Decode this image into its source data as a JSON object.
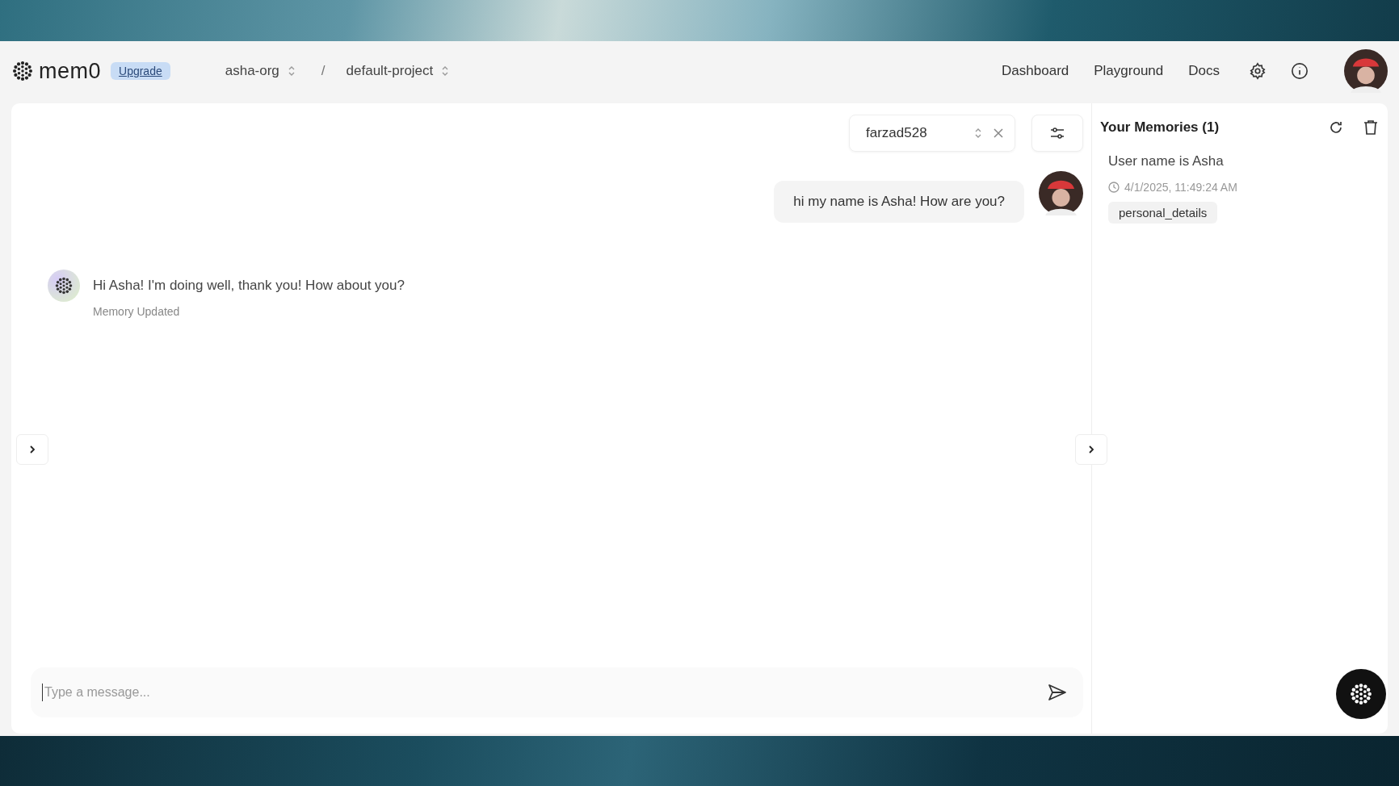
{
  "header": {
    "logo": "mem0",
    "upgrade": "Upgrade",
    "org": "asha-org",
    "separator": "/",
    "project": "default-project",
    "nav": [
      "Dashboard",
      "Playground",
      "Docs"
    ]
  },
  "chat": {
    "user_select": {
      "value": "farzad528"
    },
    "messages": [
      {
        "kind": "user",
        "text": "hi my name is Asha! How are you?"
      },
      {
        "kind": "assistant",
        "text": "Hi Asha! I'm doing well, thank you! How about you?",
        "note": "Memory Updated"
      }
    ],
    "input": {
      "placeholder": "Type a message..."
    }
  },
  "memories": {
    "title": "Your Memories (1)",
    "items": [
      {
        "text": "User name is Asha",
        "time": "4/1/2025, 11:49:24 AM",
        "tags": [
          "personal_details"
        ]
      }
    ]
  }
}
